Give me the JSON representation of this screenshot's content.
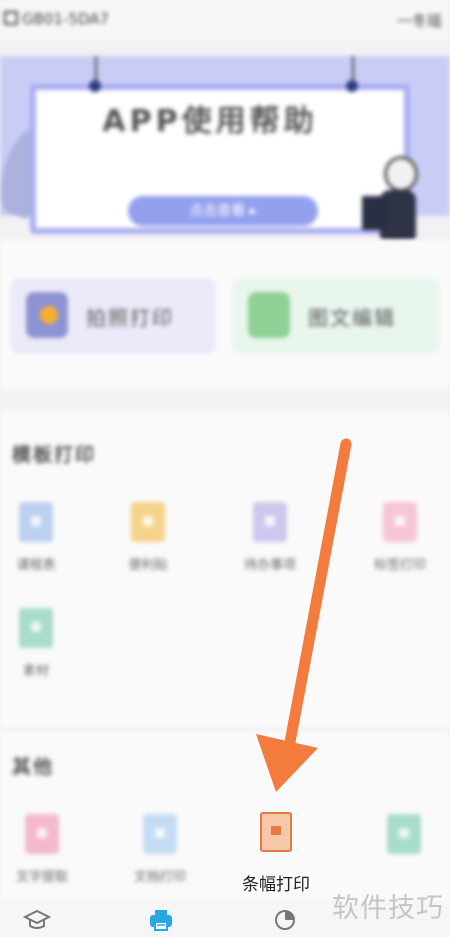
{
  "status_bar": {
    "left_text": "GB01-5DA7",
    "right_text": "一冬瑶"
  },
  "banner": {
    "title": "APP使用帮助",
    "button_label": "点击查看 ▸"
  },
  "quick_actions": [
    {
      "label": "拍照打印"
    },
    {
      "label": "图文编辑"
    }
  ],
  "template_section": {
    "title": "模板打印",
    "items": [
      {
        "label": "课程表",
        "color": "#bcd0f0"
      },
      {
        "label": "便利贴",
        "color": "#f6d38a"
      },
      {
        "label": "待办事项",
        "color": "#cfc7ee"
      },
      {
        "label": "标签打印",
        "color": "#f6c6d6"
      },
      {
        "label": "素材",
        "color": "#a9dcc9"
      }
    ]
  },
  "other_section": {
    "title": "其他",
    "items": [
      {
        "label": "文字提取",
        "color": "#f4b9cb"
      },
      {
        "label": "文档打印",
        "color": "#c5dcf5"
      },
      {
        "label": "条幅打印",
        "color": "#f6c8aa"
      },
      {
        "label": "",
        "color": "#a9dcc9"
      }
    ]
  },
  "tabbar": {
    "items": [
      {
        "icon": "graduation-cap-icon"
      },
      {
        "icon": "printer-icon"
      },
      {
        "icon": "pie-chart-icon"
      }
    ],
    "active_color": "#29a6e6"
  },
  "overlay": {
    "arrow_color": "#f47b3e",
    "watermark": "软件技巧"
  }
}
